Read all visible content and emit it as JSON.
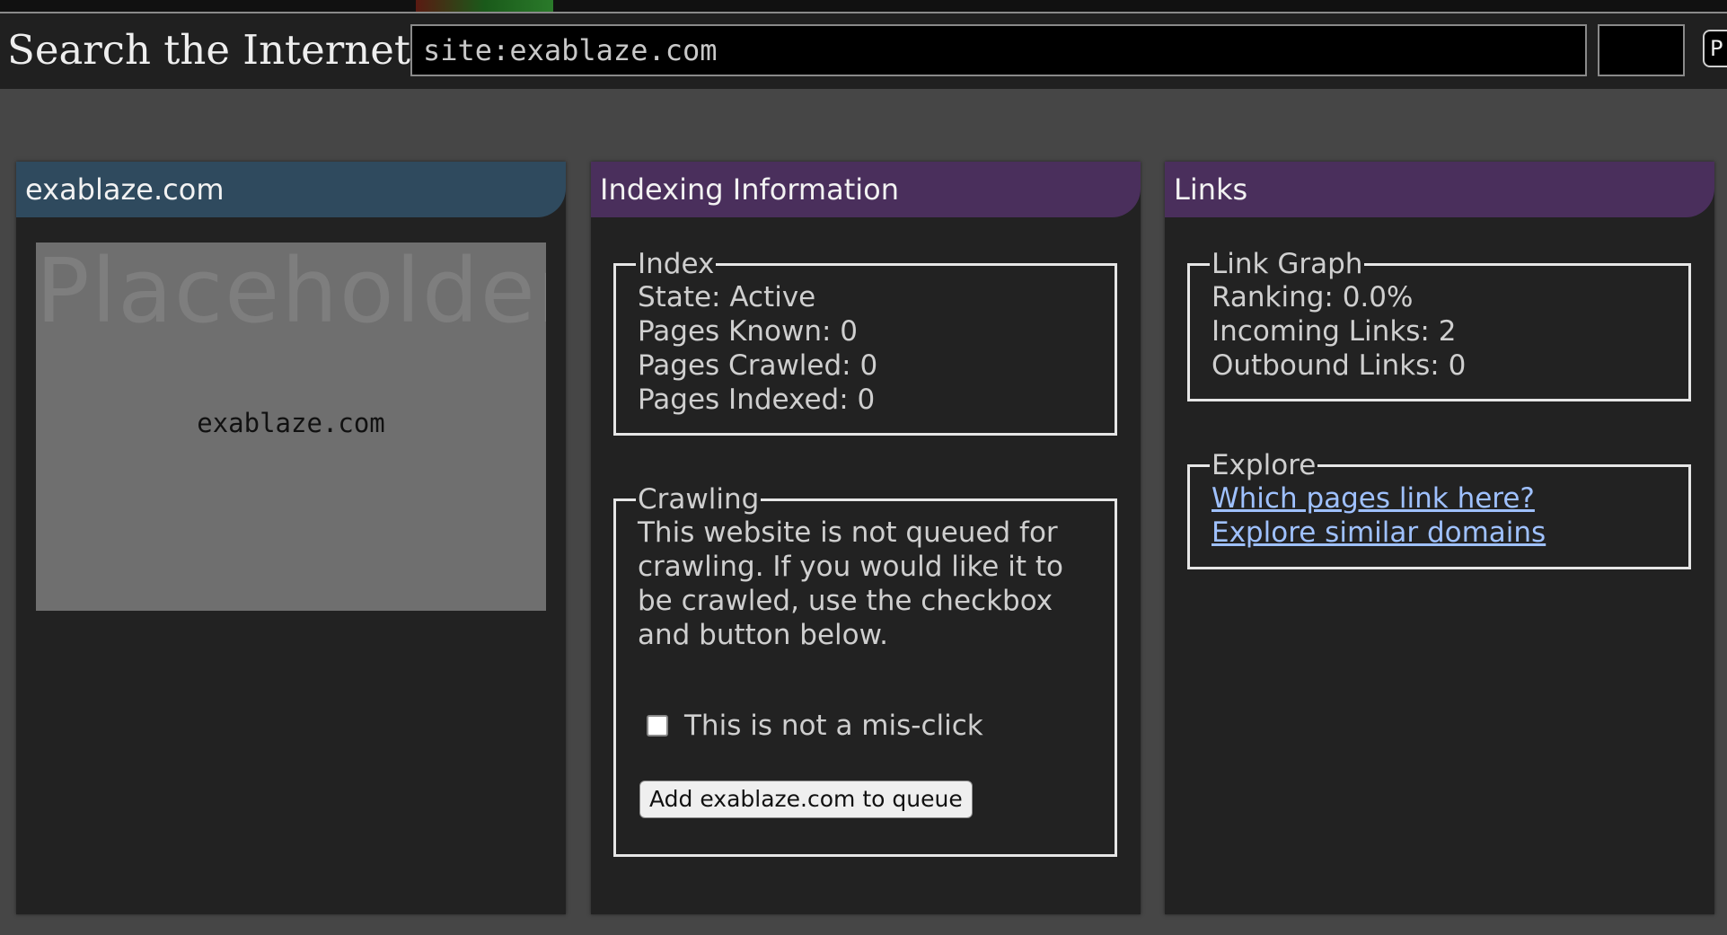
{
  "search": {
    "title": "Search the Internet",
    "query": "site:exablaze.com",
    "extra_button_label": "P"
  },
  "site_card": {
    "header": "exablaze.com",
    "placeholder_watermark": "Placeholder",
    "placeholder_domain": "exablaze.com"
  },
  "indexing_card": {
    "header": "Indexing Information",
    "index": {
      "legend": "Index",
      "lines": [
        "State: Active",
        "Pages Known: 0",
        "Pages Crawled: 0",
        "Pages Indexed: 0"
      ]
    },
    "crawling": {
      "legend": "Crawling",
      "paragraph": "This website is not queued for crawling. If you would like it to be crawled, use the checkbox and button below.",
      "checkbox_label": "This is not a mis-click",
      "button_label": "Add exablaze.com to queue"
    }
  },
  "links_card": {
    "header": "Links",
    "link_graph": {
      "legend": "Link Graph",
      "lines": [
        "Ranking: 0.0%",
        "Incoming Links: 2",
        "Outbound Links: 0"
      ]
    },
    "explore": {
      "legend": "Explore",
      "links": [
        "Which pages link here?",
        "Explore similar domains"
      ]
    }
  }
}
